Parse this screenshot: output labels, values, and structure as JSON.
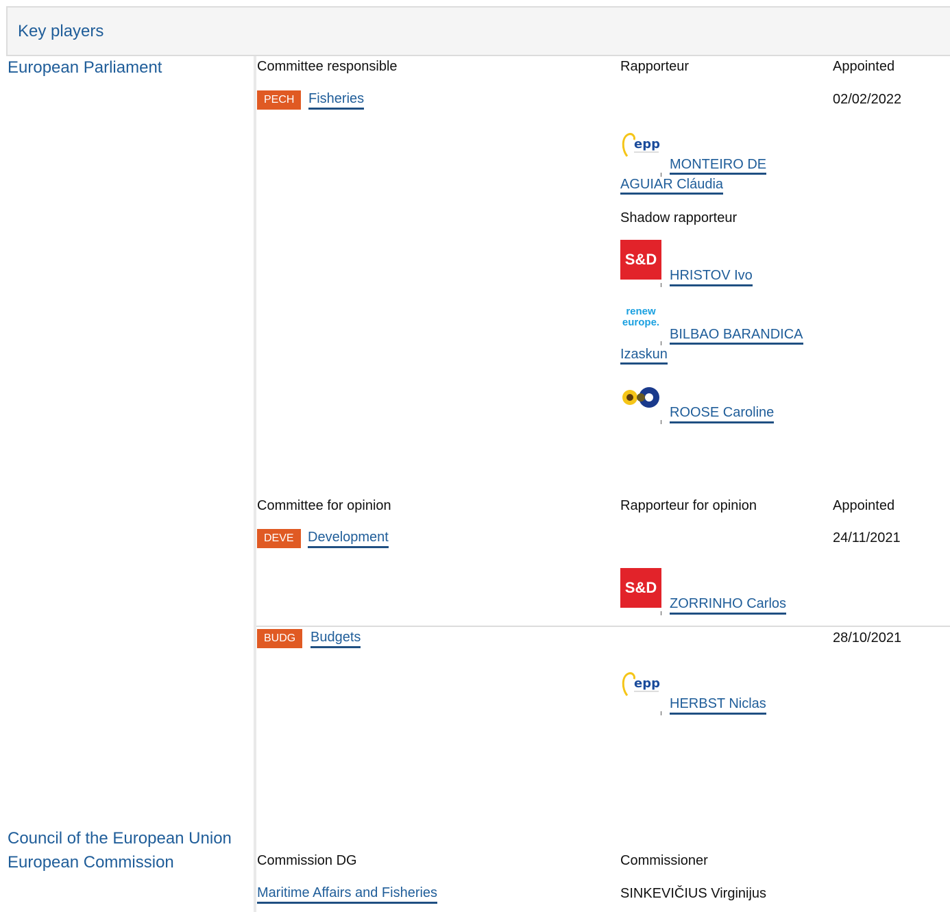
{
  "header": {
    "title": "Key players"
  },
  "institutions": {
    "parliament": "European Parliament",
    "council": "Council of the European Union",
    "commission": "European Commission"
  },
  "responsible": {
    "col_committee": "Committee responsible",
    "col_rapporteur": "Rapporteur",
    "col_appointed": "Appointed",
    "committee": {
      "code": "PECH",
      "name": "Fisheries",
      "appointed": "02/02/2022"
    },
    "rapporteur": {
      "group_logo": "epp-logo",
      "name_line1": "MONTEIRO DE",
      "name_line2": "AGUIAR Cláudia"
    },
    "shadow_label": "Shadow rapporteur",
    "shadows": [
      {
        "group_logo": "sd-logo",
        "logo_text": "S&D",
        "name": "HRISTOV Ivo"
      },
      {
        "group_logo": "renew-logo",
        "logo_text_1": "renew",
        "logo_text_2": "europe.",
        "name_line1": "BILBAO BARANDICA",
        "name_line2": "Izaskun"
      },
      {
        "group_logo": "greens-efa-logo",
        "name": "ROOSE Caroline"
      }
    ]
  },
  "opinion": {
    "col_committee": "Committee for opinion",
    "col_rapporteur": "Rapporteur for opinion",
    "col_appointed": "Appointed",
    "committees": [
      {
        "code": "DEVE",
        "name": "Development",
        "appointed": "24/11/2021",
        "rapporteur": {
          "group_logo": "sd-logo",
          "logo_text": "S&D",
          "name": "ZORRINHO Carlos"
        }
      },
      {
        "code": "BUDG",
        "name": "Budgets",
        "appointed": "28/10/2021",
        "rapporteur": {
          "group_logo": "epp-logo",
          "name": "HERBST Niclas"
        }
      }
    ]
  },
  "commission": {
    "col_dg": "Commission DG",
    "col_commissioner": "Commissioner",
    "dg": "Maritime Affairs and Fisheries",
    "commissioner": "SINKEVIČIUS Virginijus"
  },
  "colors": {
    "link": "#1f5d99",
    "badge": "#e05a23",
    "sd_red": "#e2232a",
    "renew_blue": "#1aa0e0",
    "epp_blue": "#1a4b9b",
    "epp_yellow": "#f5c518"
  }
}
